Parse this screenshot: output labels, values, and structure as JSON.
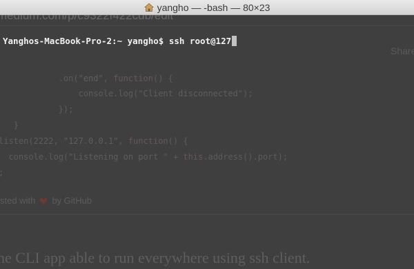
{
  "window": {
    "title": "yangho — -bash — 80×23"
  },
  "terminal": {
    "prompt": "Yanghos-MacBook-Pro-2:~ yangho$ ssh root@127",
    "cursor": "block"
  },
  "background": {
    "url_text": "medium.com/p/c9322f422cdb/edit",
    "share_text": "Share",
    "code_lines": [
      {
        "indent": "            ",
        "parts": [
          ".on(",
          "\"end\"",
          ", ",
          "function",
          "() {"
        ]
      },
      {
        "indent": "                ",
        "parts": [
          "console.log(",
          "\"Client disconnected\"",
          ");"
        ]
      },
      {
        "indent": "            ",
        "parts": [
          "});"
        ]
      },
      {
        "indent": "   ",
        "parts": [
          "}"
        ]
      },
      {
        "indent": "",
        "parts": [
          "listen(2222, ",
          "\"127.0.0.1\"",
          ", ",
          "function",
          "() {"
        ]
      },
      {
        "indent": "  ",
        "parts": [
          "console.log(",
          "\"Listening on port \"",
          " + ",
          "this",
          ".address().port);"
        ]
      },
      {
        "indent": "",
        "parts": [
          ";"
        ]
      }
    ],
    "footer_prefix": "sted with",
    "footer_suffix": "by GitHub",
    "sentence": "he CLI app able to run everywhere using ssh client."
  },
  "colors": {
    "terminal_bg": "#3f3f3f",
    "prompt_text": "#f2f2f2",
    "heart": "#6b3a30"
  }
}
